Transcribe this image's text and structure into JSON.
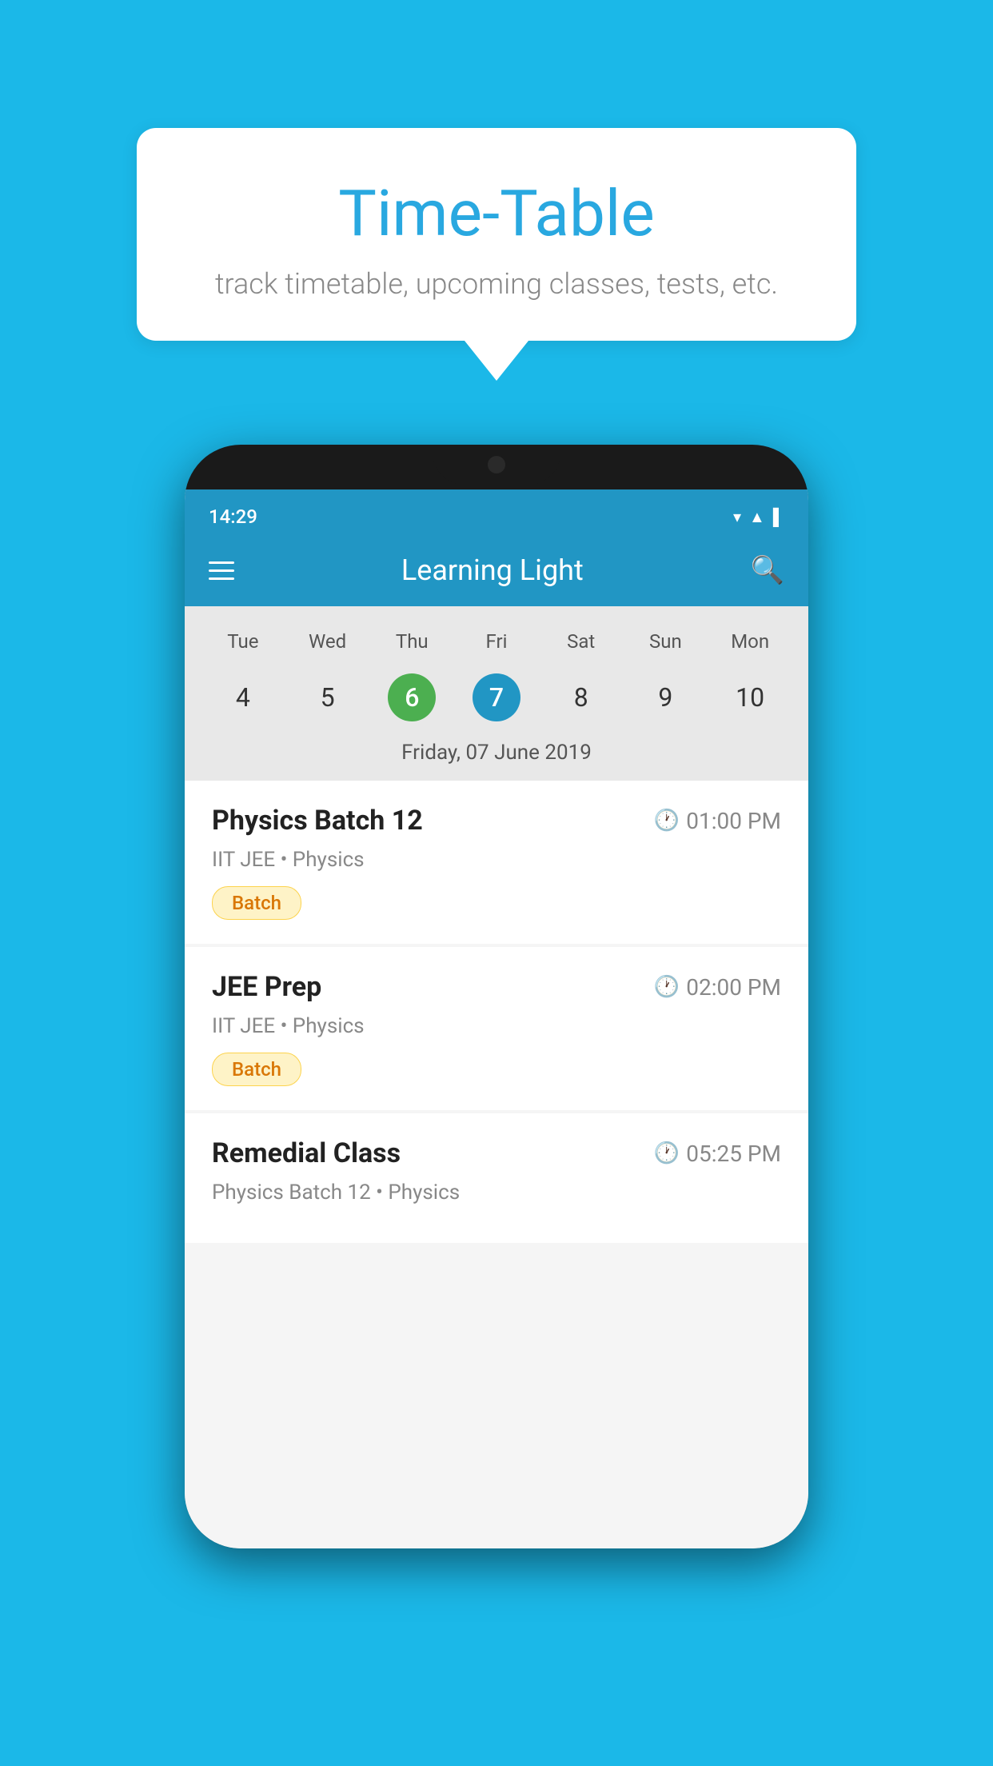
{
  "background_color": "#1bb8e8",
  "speech_bubble": {
    "title": "Time-Table",
    "subtitle": "track timetable, upcoming classes, tests, etc."
  },
  "phone": {
    "status_bar": {
      "time": "14:29"
    },
    "app_bar": {
      "title": "Learning Light"
    },
    "calendar": {
      "weekdays": [
        "Tue",
        "Wed",
        "Thu",
        "Fri",
        "Sat",
        "Sun",
        "Mon"
      ],
      "dates": [
        {
          "num": "4",
          "state": "normal"
        },
        {
          "num": "5",
          "state": "normal"
        },
        {
          "num": "6",
          "state": "today"
        },
        {
          "num": "7",
          "state": "selected"
        },
        {
          "num": "8",
          "state": "normal"
        },
        {
          "num": "9",
          "state": "normal"
        },
        {
          "num": "10",
          "state": "normal"
        }
      ],
      "selected_label": "Friday, 07 June 2019"
    },
    "schedule": [
      {
        "title": "Physics Batch 12",
        "time": "01:00 PM",
        "subtitle": "IIT JEE • Physics",
        "badge": "Batch"
      },
      {
        "title": "JEE Prep",
        "time": "02:00 PM",
        "subtitle": "IIT JEE • Physics",
        "badge": "Batch"
      },
      {
        "title": "Remedial Class",
        "time": "05:25 PM",
        "subtitle": "Physics Batch 12 • Physics",
        "badge": null
      }
    ]
  }
}
